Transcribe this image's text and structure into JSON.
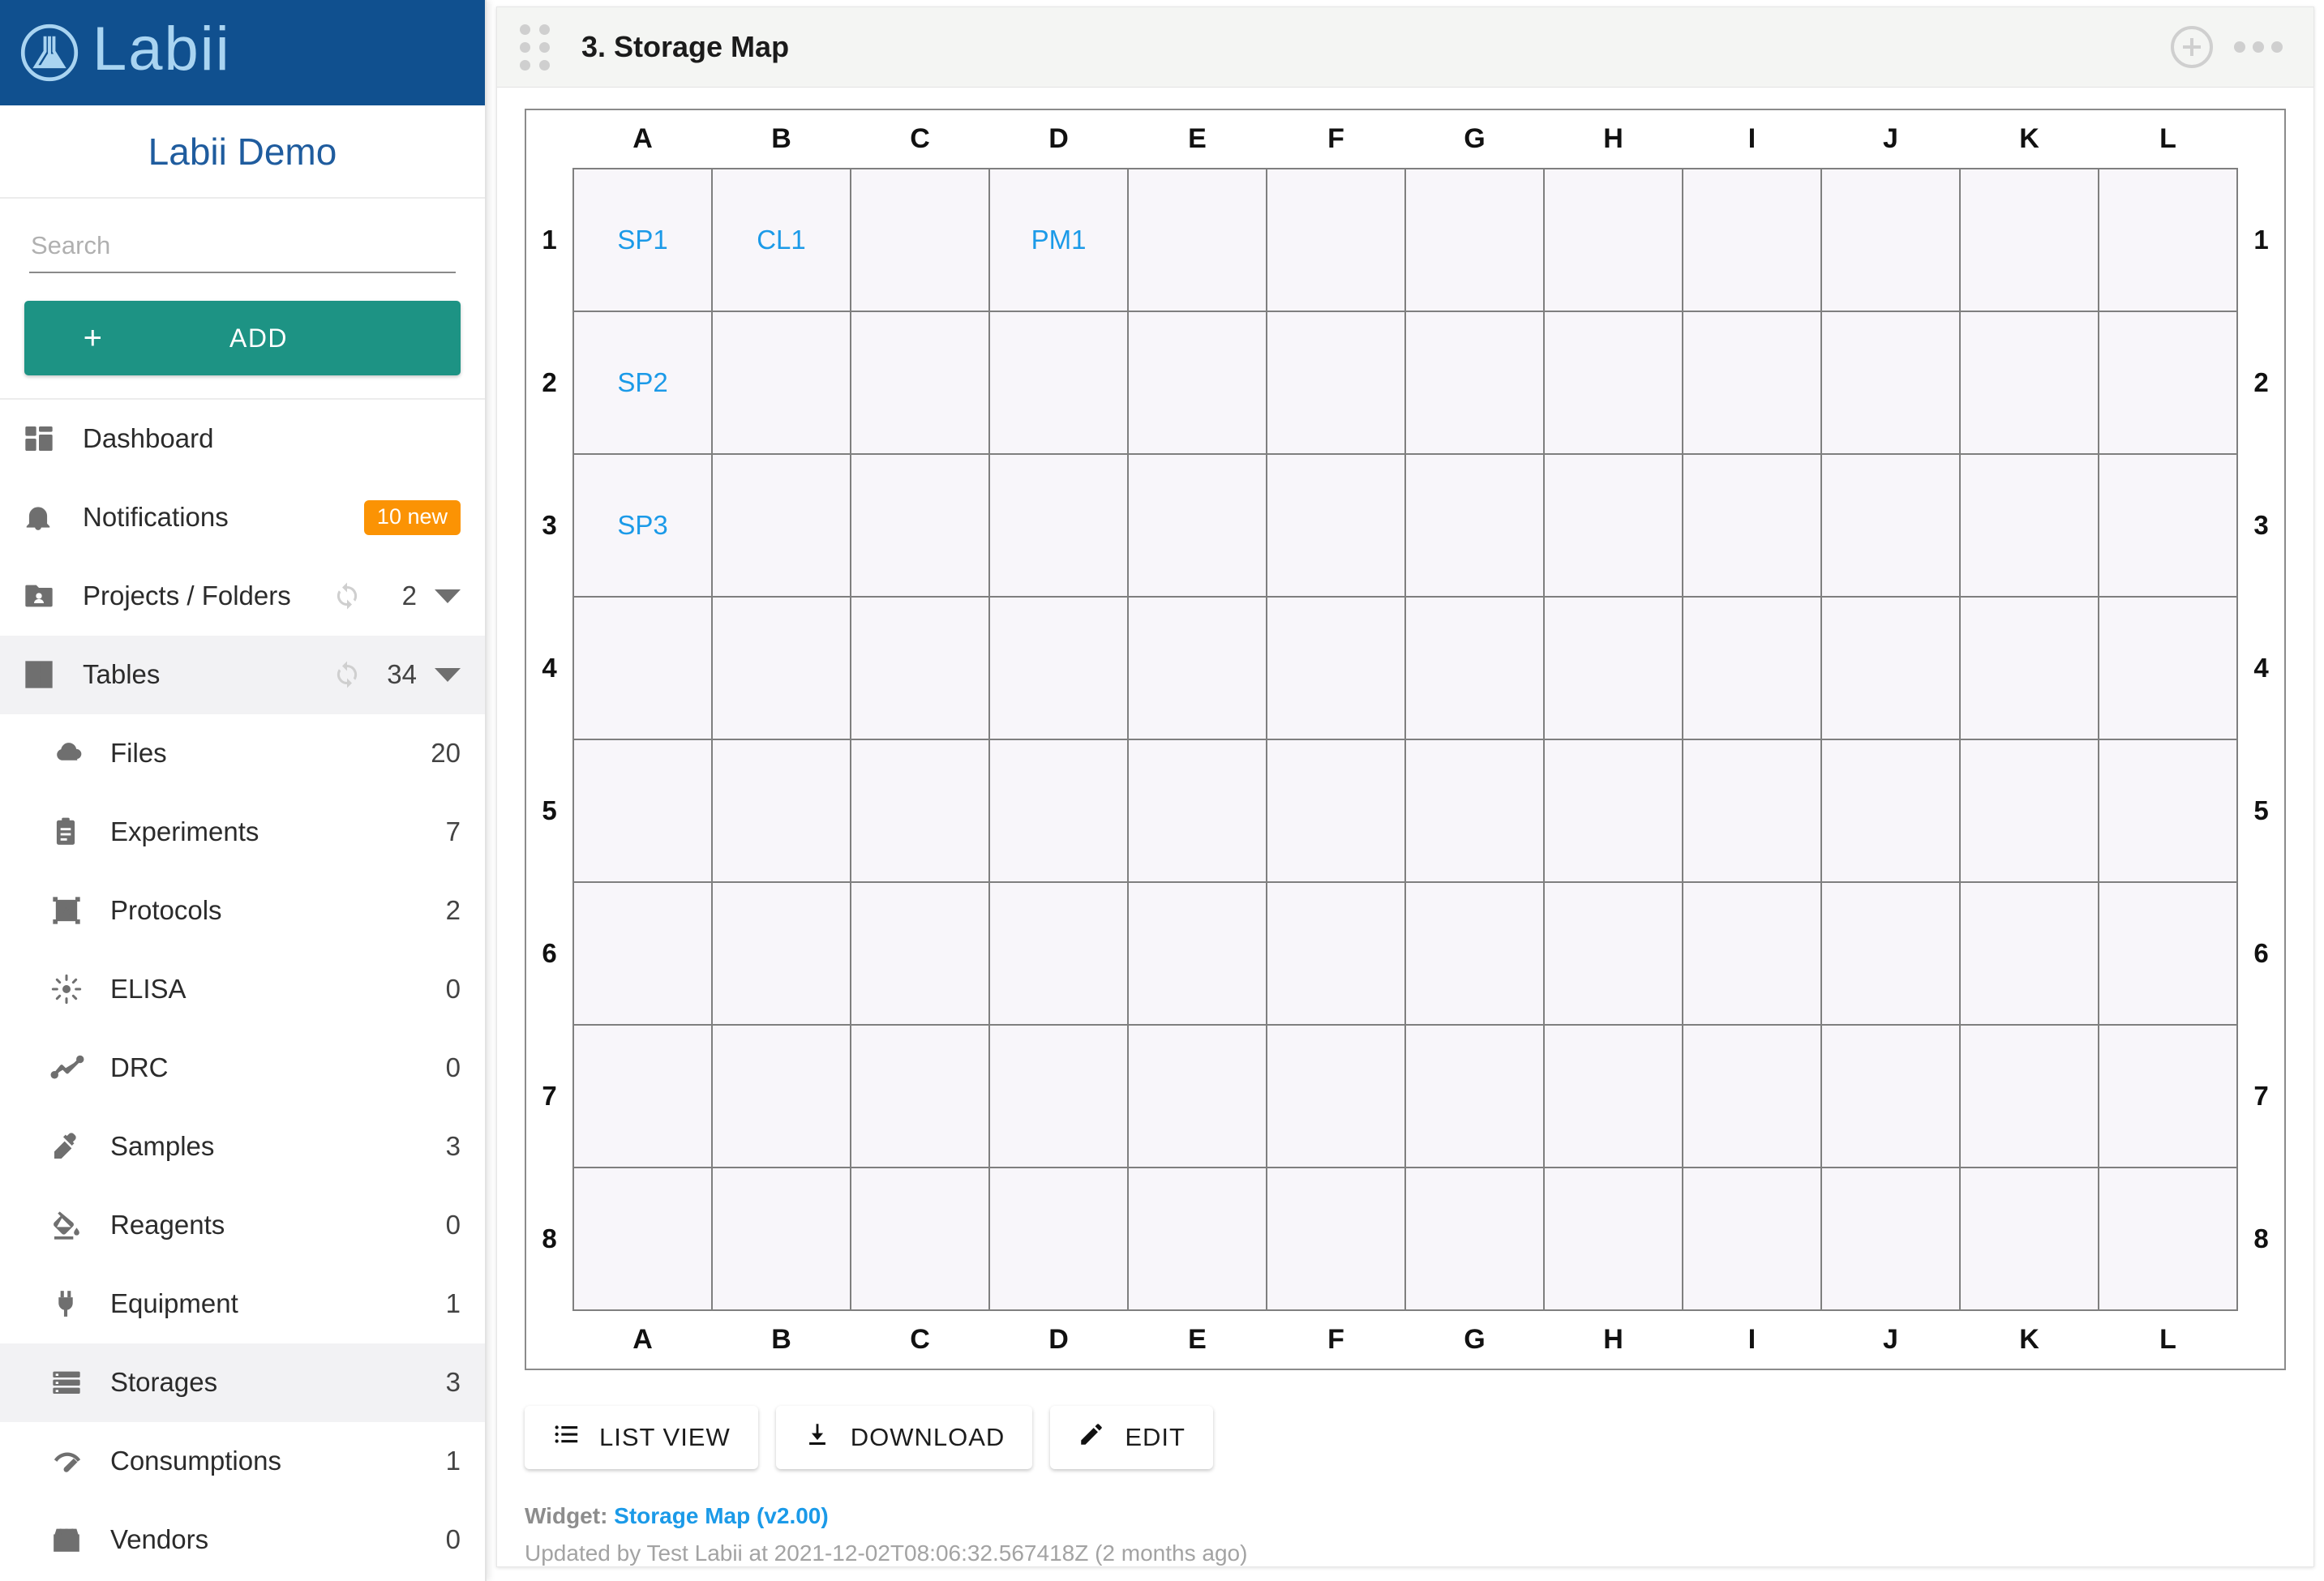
{
  "brand": {
    "name": "Labii",
    "logo_icon": "flask-circle-logo"
  },
  "workspace": {
    "title": "Labii Demo"
  },
  "search": {
    "placeholder": "Search",
    "value": "",
    "icon": "search-icon"
  },
  "add_button": {
    "plus": "+",
    "label": "ADD"
  },
  "sidebar": {
    "primary": [
      {
        "label": "Dashboard",
        "icon": "dashboard-icon",
        "count": "",
        "badge": "",
        "sync": false,
        "caret": false,
        "active": false
      },
      {
        "label": "Notifications",
        "icon": "bell-icon",
        "count": "",
        "badge": "10 new",
        "sync": false,
        "caret": false,
        "active": false
      },
      {
        "label": "Projects / Folders",
        "icon": "folder-user-icon",
        "count": "2",
        "badge": "",
        "sync": true,
        "caret": true,
        "active": false
      },
      {
        "label": "Tables",
        "icon": "table-grid-icon",
        "count": "34",
        "badge": "",
        "sync": true,
        "caret": true,
        "active": true
      }
    ],
    "tables": [
      {
        "label": "Files",
        "icon": "cloud-icon",
        "count": "20",
        "active": false
      },
      {
        "label": "Experiments",
        "icon": "clipboard-icon",
        "count": "7",
        "active": false
      },
      {
        "label": "Protocols",
        "icon": "protocol-frame-icon",
        "count": "2",
        "active": false
      },
      {
        "label": "ELISA",
        "icon": "elisa-sun-icon",
        "count": "0",
        "active": false
      },
      {
        "label": "DRC",
        "icon": "line-chart-icon",
        "count": "0",
        "active": false
      },
      {
        "label": "Samples",
        "icon": "pipette-icon",
        "count": "3",
        "active": false
      },
      {
        "label": "Reagents",
        "icon": "paint-bucket-icon",
        "count": "0",
        "active": false
      },
      {
        "label": "Equipment",
        "icon": "plug-icon",
        "count": "1",
        "active": false
      },
      {
        "label": "Storages",
        "icon": "storage-rack-icon",
        "count": "3",
        "active": true
      },
      {
        "label": "Consumptions",
        "icon": "speedometer-icon",
        "count": "1",
        "active": false
      },
      {
        "label": "Vendors",
        "icon": "storefront-icon",
        "count": "0",
        "active": false
      }
    ]
  },
  "widget": {
    "title": "3. Storage Map",
    "drag_handle_icon": "drag-dots-icon",
    "add_icon": "circle-plus-icon",
    "more_icon": "more-horizontal-icon"
  },
  "storage_map": {
    "columns": [
      "A",
      "B",
      "C",
      "D",
      "E",
      "F",
      "G",
      "H",
      "I",
      "J",
      "K",
      "L"
    ],
    "rows": [
      "1",
      "2",
      "3",
      "4",
      "5",
      "6",
      "7",
      "8"
    ],
    "occupied": {
      "1": {
        "A": "SP1",
        "B": "CL1",
        "D": "PM1"
      },
      "2": {
        "A": "SP2"
      },
      "3": {
        "A": "SP3"
      }
    }
  },
  "actions": [
    {
      "label": "LIST VIEW",
      "icon": "list-icon"
    },
    {
      "label": "DOWNLOAD",
      "icon": "download-icon"
    },
    {
      "label": "EDIT",
      "icon": "pencil-icon"
    }
  ],
  "footer": {
    "widget_prefix": "Widget:",
    "widget_link": "Storage Map (v2.00)",
    "updated": "Updated by Test Labii at 2021-12-02T08:06:32.567418Z (2 months ago)"
  },
  "colors": {
    "brand_blue": "#10508f",
    "workspace_blue": "#1f5c9e",
    "add_teal": "#1d9384",
    "badge_orange": "#fb9304",
    "link_blue": "#1b9ae8",
    "cell_fill": "#f8f6fa",
    "cell_border": "#7f7f7f"
  }
}
